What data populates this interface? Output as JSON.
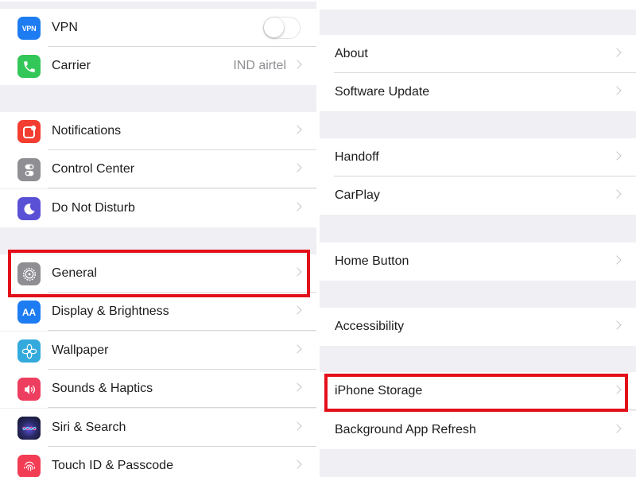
{
  "left": {
    "network": {
      "vpn": {
        "label": "VPN",
        "icon": "vpn-icon",
        "icon_text": "VPN",
        "color": "#1e7cf2",
        "toggle": "off"
      },
      "carrier": {
        "label": "Carrier",
        "value": "IND airtel",
        "icon": "phone-icon",
        "color": "#33c759"
      }
    },
    "system": {
      "notifications": {
        "label": "Notifications",
        "icon": "notifications-icon",
        "color": "#f23d30"
      },
      "control_center": {
        "label": "Control Center",
        "icon": "control-center-icon",
        "color": "#8e8e93"
      },
      "do_not_disturb": {
        "label": "Do Not Disturb",
        "icon": "moon-icon",
        "color": "#5a50d6"
      }
    },
    "general_group": {
      "general": {
        "label": "General",
        "icon": "gear-icon",
        "color": "#8e8e93",
        "highlighted": true
      },
      "display": {
        "label": "Display & Brightness",
        "icon": "display-icon",
        "icon_text": "AA",
        "color": "#1e7cf2"
      },
      "wallpaper": {
        "label": "Wallpaper",
        "icon": "wallpaper-icon",
        "color": "#34aadc"
      },
      "sounds": {
        "label": "Sounds & Haptics",
        "icon": "speaker-icon",
        "color": "#ee3e5f"
      },
      "siri": {
        "label": "Siri & Search",
        "icon": "siri-icon",
        "color": "#1f1f3a"
      },
      "touch_id": {
        "label": "Touch ID & Passcode",
        "icon": "fingerprint-icon",
        "color": "#f23d55"
      }
    }
  },
  "right": {
    "group1": {
      "about": {
        "label": "About"
      },
      "software_update": {
        "label": "Software Update"
      }
    },
    "group2": {
      "handoff": {
        "label": "Handoff"
      },
      "carplay": {
        "label": "CarPlay"
      }
    },
    "group3": {
      "home_button": {
        "label": "Home Button"
      }
    },
    "group4": {
      "accessibility": {
        "label": "Accessibility"
      }
    },
    "group5": {
      "iphone_storage": {
        "label": "iPhone Storage",
        "highlighted": true
      },
      "background_refresh": {
        "label": "Background App Refresh"
      }
    }
  },
  "highlight_color": "#e3101a"
}
